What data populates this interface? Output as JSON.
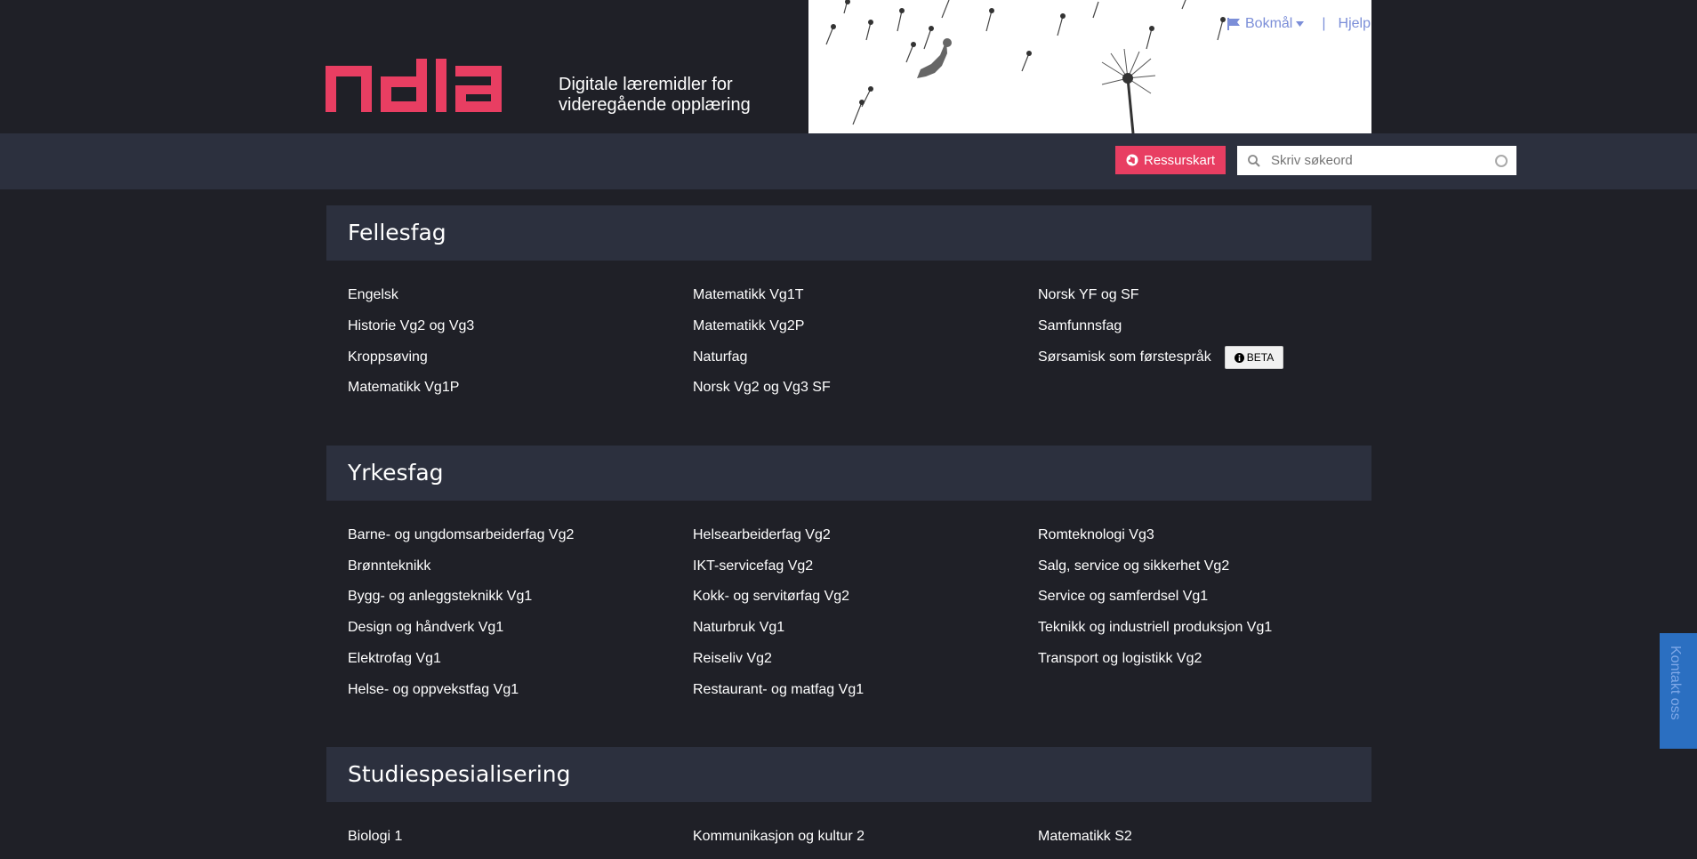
{
  "header": {
    "logo_text": "ndla",
    "tagline_line1": "Digitale læremidler for",
    "tagline_line2": "videregående opplæring",
    "language": "Bokmål",
    "separator": "|",
    "help": "Hjelp"
  },
  "toolbar": {
    "resource_map_label": "Ressurskart",
    "search_placeholder": "Skriv søkeord"
  },
  "sections": [
    {
      "title": "Fellesfag",
      "columns": [
        [
          "Engelsk",
          "Historie Vg2 og Vg3",
          "Kroppsøving",
          "Matematikk Vg1P"
        ],
        [
          "Matematikk Vg1T",
          "Matematikk Vg2P",
          "Naturfag",
          "Norsk Vg2 og Vg3 SF"
        ],
        [
          "Norsk YF og SF",
          "Samfunnsfag",
          "Sørsamisk som førstespråk"
        ]
      ],
      "badge": "BETA"
    },
    {
      "title": "Yrkesfag",
      "columns": [
        [
          "Barne- og ungdomsarbeiderfag Vg2",
          "Brønnteknikk",
          "Bygg- og anleggsteknikk Vg1",
          "Design og håndverk Vg1",
          "Elektrofag Vg1",
          "Helse- og oppvekstfag Vg1"
        ],
        [
          "Helsearbeiderfag Vg2",
          "IKT-servicefag Vg2",
          "Kokk- og servitørfag Vg2",
          "Naturbruk Vg1",
          "Reiseliv Vg2",
          "Restaurant- og matfag Vg1"
        ],
        [
          "Romteknologi Vg3",
          "Salg, service og sikkerhet Vg2",
          "Service og samferdsel Vg1",
          "Teknikk og industriell produksjon Vg1",
          "Transport og logistikk Vg2"
        ]
      ]
    },
    {
      "title": "Studiespesialisering",
      "columns": [
        [
          "Biologi 1"
        ],
        [
          "Kommunikasjon og kultur 2"
        ],
        [
          "Matematikk S2"
        ]
      ]
    }
  ],
  "contact_tab": "Kontakt oss",
  "colors": {
    "background": "#1f2027",
    "panel": "#2c303e",
    "brand": "#e83e62",
    "link": "#7b8ed8",
    "contact": "#2b6fc1"
  }
}
